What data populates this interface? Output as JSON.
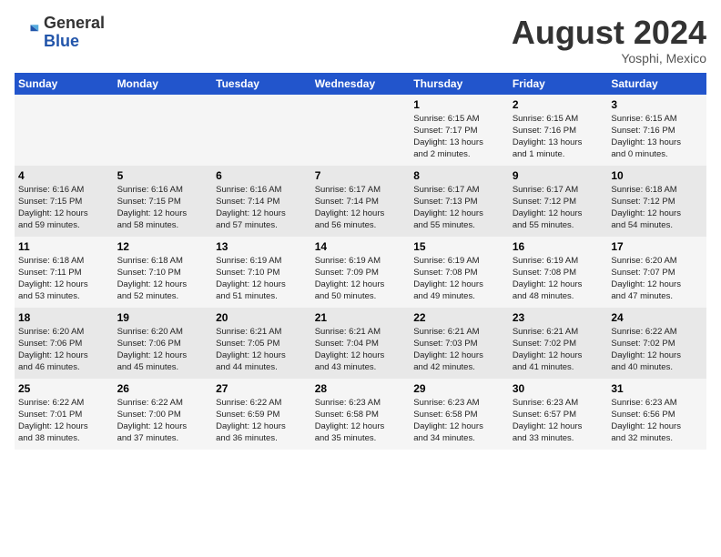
{
  "header": {
    "logo_general": "General",
    "logo_blue": "Blue",
    "title": "August 2024",
    "location": "Yosphi, Mexico"
  },
  "calendar": {
    "days_of_week": [
      "Sunday",
      "Monday",
      "Tuesday",
      "Wednesday",
      "Thursday",
      "Friday",
      "Saturday"
    ],
    "weeks": [
      [
        {
          "day": "",
          "info": ""
        },
        {
          "day": "",
          "info": ""
        },
        {
          "day": "",
          "info": ""
        },
        {
          "day": "",
          "info": ""
        },
        {
          "day": "1",
          "info": "Sunrise: 6:15 AM\nSunset: 7:17 PM\nDaylight: 13 hours\nand 2 minutes."
        },
        {
          "day": "2",
          "info": "Sunrise: 6:15 AM\nSunset: 7:16 PM\nDaylight: 13 hours\nand 1 minute."
        },
        {
          "day": "3",
          "info": "Sunrise: 6:15 AM\nSunset: 7:16 PM\nDaylight: 13 hours\nand 0 minutes."
        }
      ],
      [
        {
          "day": "4",
          "info": "Sunrise: 6:16 AM\nSunset: 7:15 PM\nDaylight: 12 hours\nand 59 minutes."
        },
        {
          "day": "5",
          "info": "Sunrise: 6:16 AM\nSunset: 7:15 PM\nDaylight: 12 hours\nand 58 minutes."
        },
        {
          "day": "6",
          "info": "Sunrise: 6:16 AM\nSunset: 7:14 PM\nDaylight: 12 hours\nand 57 minutes."
        },
        {
          "day": "7",
          "info": "Sunrise: 6:17 AM\nSunset: 7:14 PM\nDaylight: 12 hours\nand 56 minutes."
        },
        {
          "day": "8",
          "info": "Sunrise: 6:17 AM\nSunset: 7:13 PM\nDaylight: 12 hours\nand 55 minutes."
        },
        {
          "day": "9",
          "info": "Sunrise: 6:17 AM\nSunset: 7:12 PM\nDaylight: 12 hours\nand 55 minutes."
        },
        {
          "day": "10",
          "info": "Sunrise: 6:18 AM\nSunset: 7:12 PM\nDaylight: 12 hours\nand 54 minutes."
        }
      ],
      [
        {
          "day": "11",
          "info": "Sunrise: 6:18 AM\nSunset: 7:11 PM\nDaylight: 12 hours\nand 53 minutes."
        },
        {
          "day": "12",
          "info": "Sunrise: 6:18 AM\nSunset: 7:10 PM\nDaylight: 12 hours\nand 52 minutes."
        },
        {
          "day": "13",
          "info": "Sunrise: 6:19 AM\nSunset: 7:10 PM\nDaylight: 12 hours\nand 51 minutes."
        },
        {
          "day": "14",
          "info": "Sunrise: 6:19 AM\nSunset: 7:09 PM\nDaylight: 12 hours\nand 50 minutes."
        },
        {
          "day": "15",
          "info": "Sunrise: 6:19 AM\nSunset: 7:08 PM\nDaylight: 12 hours\nand 49 minutes."
        },
        {
          "day": "16",
          "info": "Sunrise: 6:19 AM\nSunset: 7:08 PM\nDaylight: 12 hours\nand 48 minutes."
        },
        {
          "day": "17",
          "info": "Sunrise: 6:20 AM\nSunset: 7:07 PM\nDaylight: 12 hours\nand 47 minutes."
        }
      ],
      [
        {
          "day": "18",
          "info": "Sunrise: 6:20 AM\nSunset: 7:06 PM\nDaylight: 12 hours\nand 46 minutes."
        },
        {
          "day": "19",
          "info": "Sunrise: 6:20 AM\nSunset: 7:06 PM\nDaylight: 12 hours\nand 45 minutes."
        },
        {
          "day": "20",
          "info": "Sunrise: 6:21 AM\nSunset: 7:05 PM\nDaylight: 12 hours\nand 44 minutes."
        },
        {
          "day": "21",
          "info": "Sunrise: 6:21 AM\nSunset: 7:04 PM\nDaylight: 12 hours\nand 43 minutes."
        },
        {
          "day": "22",
          "info": "Sunrise: 6:21 AM\nSunset: 7:03 PM\nDaylight: 12 hours\nand 42 minutes."
        },
        {
          "day": "23",
          "info": "Sunrise: 6:21 AM\nSunset: 7:02 PM\nDaylight: 12 hours\nand 41 minutes."
        },
        {
          "day": "24",
          "info": "Sunrise: 6:22 AM\nSunset: 7:02 PM\nDaylight: 12 hours\nand 40 minutes."
        }
      ],
      [
        {
          "day": "25",
          "info": "Sunrise: 6:22 AM\nSunset: 7:01 PM\nDaylight: 12 hours\nand 38 minutes."
        },
        {
          "day": "26",
          "info": "Sunrise: 6:22 AM\nSunset: 7:00 PM\nDaylight: 12 hours\nand 37 minutes."
        },
        {
          "day": "27",
          "info": "Sunrise: 6:22 AM\nSunset: 6:59 PM\nDaylight: 12 hours\nand 36 minutes."
        },
        {
          "day": "28",
          "info": "Sunrise: 6:23 AM\nSunset: 6:58 PM\nDaylight: 12 hours\nand 35 minutes."
        },
        {
          "day": "29",
          "info": "Sunrise: 6:23 AM\nSunset: 6:58 PM\nDaylight: 12 hours\nand 34 minutes."
        },
        {
          "day": "30",
          "info": "Sunrise: 6:23 AM\nSunset: 6:57 PM\nDaylight: 12 hours\nand 33 minutes."
        },
        {
          "day": "31",
          "info": "Sunrise: 6:23 AM\nSunset: 6:56 PM\nDaylight: 12 hours\nand 32 minutes."
        }
      ]
    ]
  }
}
